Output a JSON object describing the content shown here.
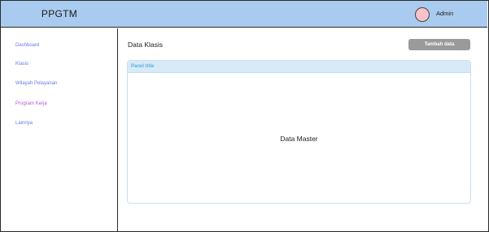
{
  "header": {
    "brand": "PPGTM",
    "user_name": "Admin"
  },
  "sidebar": {
    "items": [
      {
        "label": "Dashboard"
      },
      {
        "label": "Klasis"
      },
      {
        "label": "Wilayah Pelayanan"
      },
      {
        "label": "Program Kerja"
      },
      {
        "label": "Lainnya"
      }
    ]
  },
  "main": {
    "title": "Data Klasis",
    "add_button_label": "Tambah data",
    "panel": {
      "title": "Panel title",
      "body_text": "Data Master"
    }
  },
  "colors": {
    "header_bg": "#a9cbef",
    "avatar": "#f8c2c9",
    "nav_link": "#6a7ae8",
    "nav_link_active": "#b45ad8",
    "button_bg": "#9a9a9a",
    "panel_heading_bg": "#d8eaf8",
    "panel_title": "#5fb0de"
  }
}
